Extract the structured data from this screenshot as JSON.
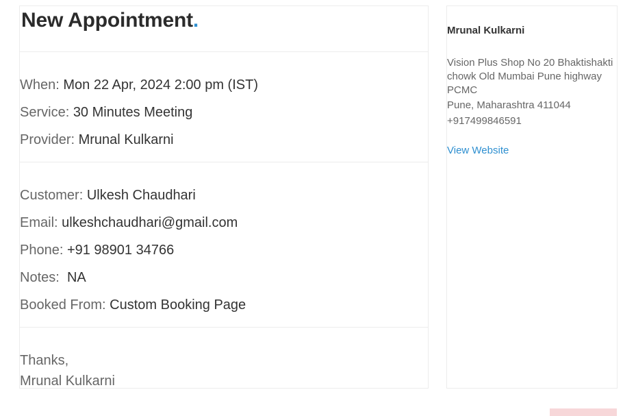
{
  "email": {
    "title": "New Appointment",
    "title_dot": ".",
    "appointment": {
      "when_label": "When:",
      "when_value": "Mon 22 Apr, 2024 2:00 pm (IST)",
      "service_label": "Service:",
      "service_value": "30 Minutes Meeting",
      "provider_label": "Provider:",
      "provider_value": "Mrunal Kulkarni"
    },
    "customer": {
      "customer_label": "Customer:",
      "customer_value": "Ulkesh Chaudhari",
      "email_label": "Email:",
      "email_value": "ulkeshchaudhari@gmail.com",
      "phone_label": "Phone:",
      "phone_value": "+91 98901 34766",
      "notes_label": "Notes:",
      "notes_value": "NA",
      "booked_label": "Booked From:",
      "booked_value": "Custom Booking Page"
    },
    "closing": {
      "thanks": "Thanks,",
      "signature": "Mrunal Kulkarni"
    }
  },
  "sidebar": {
    "name": "Mrunal Kulkarni",
    "address_line1": "Vision Plus Shop No 20 Bhaktishakti",
    "address_line2": "chowk Old Mumbai Pune highway",
    "address_line3": "PCMC",
    "address_line4": "Pune, Maharashtra 411044",
    "phone": "+917499846591",
    "website_label": "View Website"
  },
  "colors": {
    "accent": "#2e8fd0",
    "label_gray": "#666666",
    "value_dark": "#333333",
    "border": "#ececec",
    "corner_block": "#f7d7d9"
  }
}
